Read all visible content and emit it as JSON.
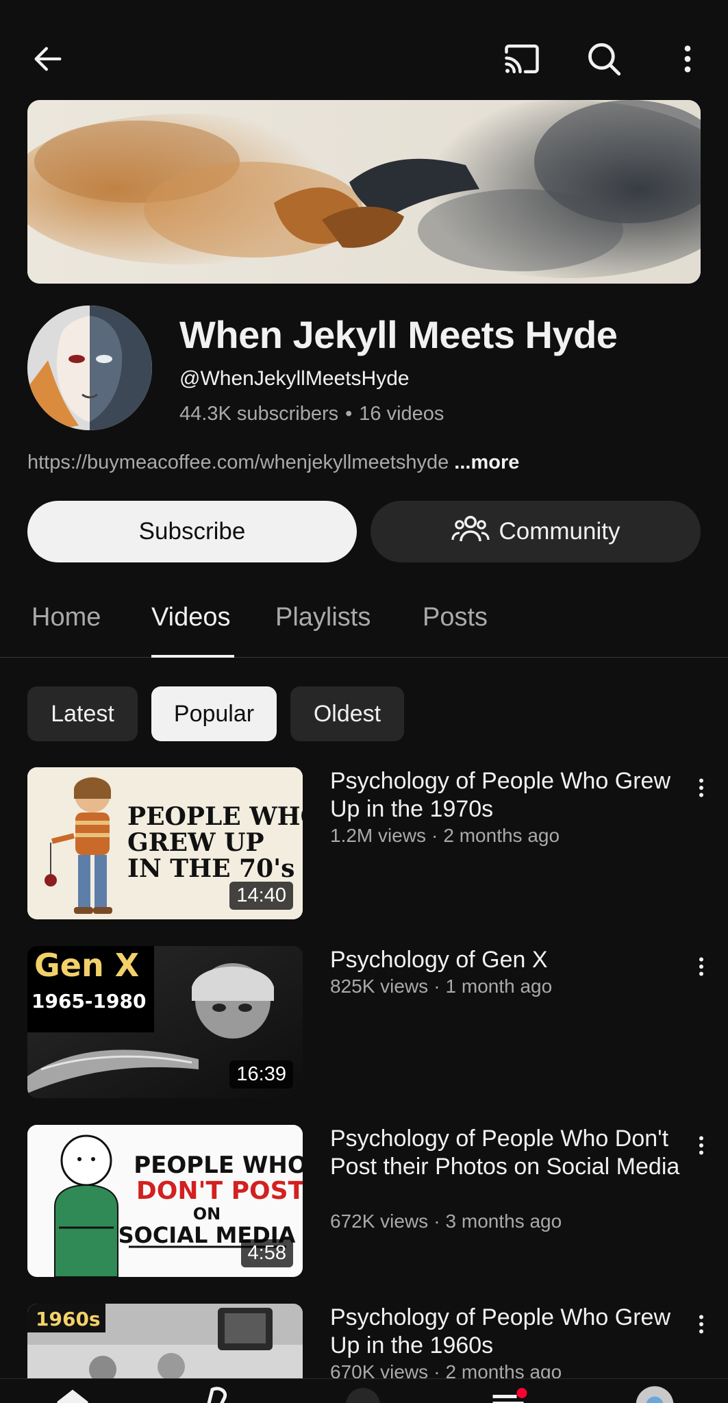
{
  "channel": {
    "name": "When Jekyll Meets Hyde",
    "handle": "@WhenJekyllMeetsHyde",
    "subscribers": "44.3K subscribers",
    "videos_count": "16 videos",
    "link": "https://buymeacoffee.com/whenjekyllmeetshyde",
    "more_label": "...more"
  },
  "actions": {
    "subscribe_label": "Subscribe",
    "community_label": "Community"
  },
  "tabs": [
    {
      "label": "Home"
    },
    {
      "label": "Videos",
      "active": true
    },
    {
      "label": "Playlists"
    },
    {
      "label": "Posts"
    }
  ],
  "chips": [
    {
      "label": "Latest"
    },
    {
      "label": "Popular",
      "selected": true
    },
    {
      "label": "Oldest"
    }
  ],
  "videos": [
    {
      "title": "Psychology of People Who Grew Up in the 1970s",
      "views": "1.2M views",
      "age": "2 months ago",
      "duration": "14:40",
      "thumb_text": [
        "PEOPLE WHO",
        "GREW UP",
        "IN THE 70's"
      ]
    },
    {
      "title": "Psychology of Gen X",
      "views": "825K views",
      "age": "1 month ago",
      "duration": "16:39",
      "thumb_text": [
        "Gen X",
        "1965-1980"
      ]
    },
    {
      "title": "Psychology of People Who Don't Post their Photos on Social Media",
      "views": "672K views",
      "age": "3 months ago",
      "duration": "4:58",
      "thumb_text": [
        "PEOPLE WHO",
        "DON'T POST",
        "ON",
        "SOCIAL MEDIA"
      ]
    },
    {
      "title": "Psychology of People Who Grew Up in the 1960s",
      "views": "670K views",
      "age": "2 months ago",
      "duration": "",
      "thumb_text": [
        "1960s"
      ]
    }
  ],
  "colors": {
    "background": "#0f0f0f",
    "text_primary": "#f1f1f1",
    "text_secondary": "#aaaaaa",
    "chip_bg": "#272727",
    "notification_dot": "#ff0033"
  },
  "icons": {
    "back": "arrow-left-icon",
    "cast": "cast-icon",
    "search": "search-icon",
    "more": "more-vert-icon",
    "community": "people-icon"
  }
}
